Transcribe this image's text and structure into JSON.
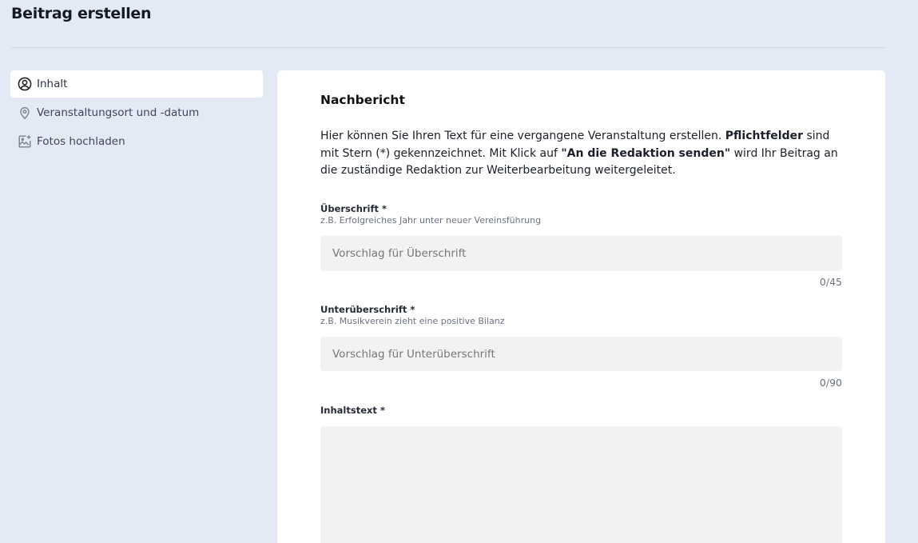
{
  "header": {
    "title": "Beitrag erstellen"
  },
  "sidebar": {
    "items": [
      {
        "label": "Inhalt",
        "icon": "user-circle-icon",
        "active": true
      },
      {
        "label": "Veranstaltungsort und -datum",
        "icon": "location-pin-icon",
        "active": false
      },
      {
        "label": "Fotos hochladen",
        "icon": "image-add-icon",
        "active": false
      }
    ]
  },
  "main": {
    "section_title": "Nachbericht",
    "intro": {
      "part1": "Hier können Sie Ihren Text für eine vergangene Veranstaltung erstellen. ",
      "bold1": "Pflichtfelder",
      "part2": " sind mit Stern (*) gekennzeichnet. Mit Klick auf ",
      "bold2": "\"An die Redaktion senden\"",
      "part3": " wird Ihr Beitrag an die zuständige Redaktion zur Weiterbearbeitung weitergeleitet."
    },
    "fields": {
      "headline": {
        "label": "Überschrift *",
        "hint": "z.B. Erfolgreiches Jahr unter neuer Vereinsführung",
        "placeholder": "Vorschlag für Überschrift",
        "value": "",
        "counter": "0/45"
      },
      "subheadline": {
        "label": "Unterüberschrift *",
        "hint": "z.B. Musikverein zieht eine positive Bilanz",
        "placeholder": "Vorschlag für Unterüberschrift",
        "value": "",
        "counter": "0/90"
      },
      "body": {
        "label": "Inhaltstext *",
        "value": ""
      }
    }
  }
}
